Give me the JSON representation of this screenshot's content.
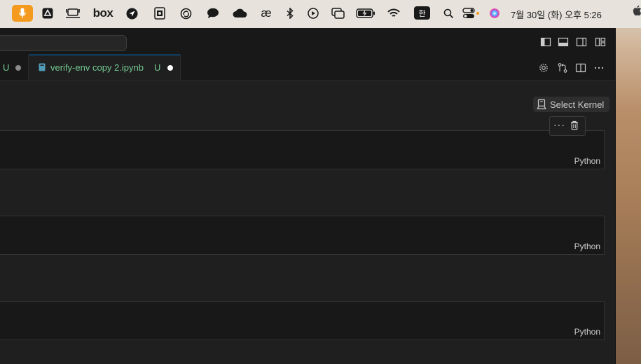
{
  "menubar": {
    "icons": [
      "microphone-icon",
      "google-drive-icon",
      "screen-share-icon",
      "box-icon",
      "location-arrow-icon",
      "office-icon",
      "sync-icon",
      "chat-bubble-icon",
      "cloud-icon",
      "ae-icon",
      "bluetooth-icon",
      "play-circle-icon",
      "window-overlap-icon",
      "battery-charging-icon",
      "wifi-icon",
      "input-source-icon",
      "spotlight-search-icon",
      "control-center-icon",
      "siri-icon"
    ],
    "box_label": "box",
    "ae_label": "æ",
    "input_source_label": "한",
    "clock": "7월 30일 (화) 오후 5:26"
  },
  "titlebar": {
    "layout_buttons": [
      "toggle-primary-sidebar",
      "toggle-panel",
      "toggle-secondary-sidebar",
      "customize-layout"
    ]
  },
  "tabs": [
    {
      "name": "",
      "status": "U",
      "dirty": true,
      "active": false
    },
    {
      "name": "verify-env copy 2.ipynb",
      "status": "U",
      "dirty": true,
      "active": true
    }
  ],
  "tab_actions": [
    "settings-gear",
    "open-changes",
    "split-editor",
    "more-actions"
  ],
  "notebook": {
    "kernel_label": "Select Kernel",
    "cell_toolbar": {
      "more_label": "···"
    },
    "cells": [
      {
        "language": "Python"
      },
      {
        "language": "Python"
      },
      {
        "language": "Python"
      }
    ]
  },
  "colors": {
    "accent": "#0078d4",
    "untracked": "#73c991",
    "mic_orange": "#f49a1e"
  }
}
